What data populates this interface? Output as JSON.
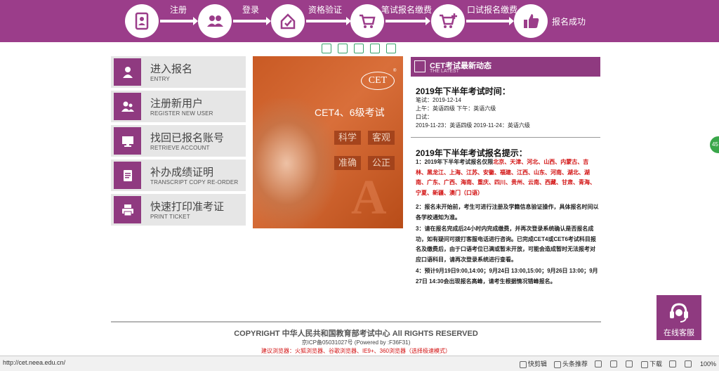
{
  "steps": [
    {
      "label": "注册",
      "icon": "register-form-icon"
    },
    {
      "label": "登录",
      "icon": "users-icon"
    },
    {
      "label": "资格验证",
      "icon": "verify-icon"
    },
    {
      "label": "笔试报名缴费",
      "icon": "cart-icon"
    },
    {
      "label": "口试报名缴费",
      "icon": "cart-plus-icon"
    },
    {
      "label": "报名成功",
      "icon": "thumbs-up-icon"
    }
  ],
  "menu": [
    {
      "title": "进入报名",
      "subtitle": "ENTRY",
      "icon": "user-icon"
    },
    {
      "title": "注册新用户",
      "subtitle": "REGISTER NEW USER",
      "icon": "add-user-icon"
    },
    {
      "title": "找回已报名账号",
      "subtitle": "RETRIEVE ACCOUNT",
      "icon": "monitor-icon"
    },
    {
      "title": "补办成绩证明",
      "subtitle": "TRANSCRIPT COPY RE-ORDER",
      "icon": "document-icon"
    },
    {
      "title": "快速打印准考证",
      "subtitle": "PRINT TICKET",
      "icon": "printer-icon"
    }
  ],
  "banner": {
    "logo": "CET",
    "reg_mark": "®",
    "title": "CET4、6级考试",
    "tags": [
      "科学",
      "客观",
      "准确",
      "公正"
    ],
    "letter": "A"
  },
  "news": {
    "header_title": "CET考试最新动态",
    "header_sub": "THE LATEST",
    "schedule_title": "2019年下半年考试时间：",
    "schedule_lines": [
      "笔试：2019-12-14",
      "上午：英语四级    下午：英语六级",
      "口试：",
      "2019-11-23：英语四级    2019-11-24：英语六级"
    ],
    "tips_title": "2019年下半年考试报名提示：",
    "tip1_prefix": "1：2019年下半年考试报名仅限",
    "tip1_red": "北京、天津、河北、山西、内蒙古、吉林、黑龙江、上海、江苏、安徽、福建、江西、山东、河南、湖北、湖南、广东、广西、海南、重庆、四川、贵州、云南、西藏、甘肃、青海、宁夏、新疆、澳门（口语）",
    "tip2": "2：报名未开始前，考生可进行注册及学籍信息验证操作，具体报名时间以各学校通知为准。",
    "tip3": "3：请在报名完成后24小时内完成缴费，并再次登录系统确认是否报名成功，如有疑问可拨打客服电话进行咨询。已完成CET4或CET6考试科目报名及缴费后，由于口语考位已满或暂未开放，可能会造成暂时无法报考对应口语科目，请再次登录系统进行查看。",
    "tip4": "4：预计9月19日9:00,14:00；9月24日 13:00,15:00；9月26日 13:00；9月27日 14:30会出现报名高峰，请考生根据情况错峰报名。"
  },
  "footer": {
    "copyright": "COPYRIGHT 中华人民共和国教育部考试中心 All RIGHTS RESERVED",
    "icp": "京ICP备05031027号  (Powered by :F36F31)",
    "browsers": "建议浏览器：火狐浏览器、谷歌浏览器、IE9+、360浏览器（选择极速模式）"
  },
  "service": {
    "label": "在线客服"
  },
  "side_badge": "45",
  "statusbar": {
    "url": "http://cet.neea.edu.cn/",
    "items": [
      "快剪辑",
      "头条推荐",
      "",
      "",
      "",
      "下载",
      "",
      "",
      "100%"
    ]
  },
  "colors": {
    "brand": "#9b3d8a",
    "accent_red": "#d21010",
    "banner_orange": "#d96f3a"
  }
}
